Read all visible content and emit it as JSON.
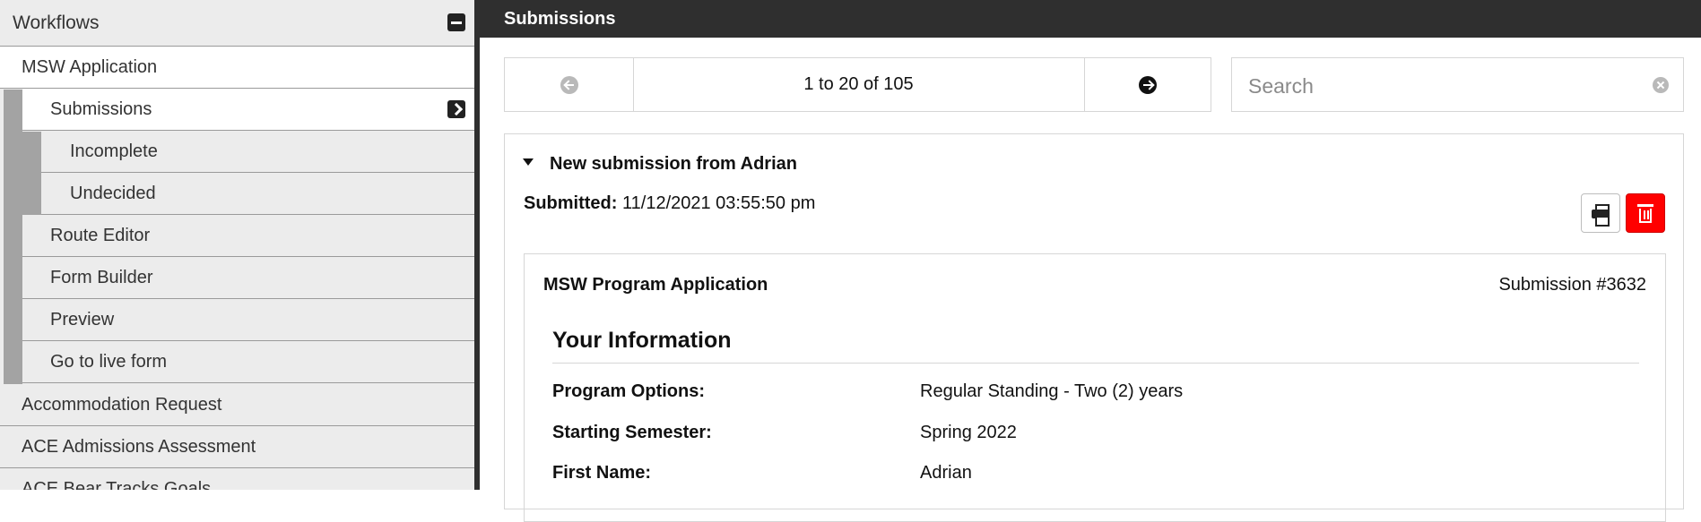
{
  "sidebar": {
    "header": "Workflows",
    "items": [
      {
        "label": "MSW Application"
      },
      {
        "label": "Submissions"
      },
      {
        "label": "Incomplete"
      },
      {
        "label": "Undecided"
      },
      {
        "label": "Route Editor"
      },
      {
        "label": "Form Builder"
      },
      {
        "label": "Preview"
      },
      {
        "label": "Go to live form"
      },
      {
        "label": "Accommodation Request"
      },
      {
        "label": "ACE Admissions Assessment"
      },
      {
        "label": "ACE Bear Tracks Goals"
      }
    ]
  },
  "topbar": {
    "title": "Submissions"
  },
  "pager": {
    "range": "1 to 20 of 105"
  },
  "search": {
    "placeholder": "Search",
    "value": ""
  },
  "submission": {
    "title": "New submission from Adrian",
    "submitted_label": "Submitted:",
    "submitted_value": "11/12/2021 03:55:50 pm",
    "form_title": "MSW Program Application",
    "number": "Submission #3632",
    "section": "Your Information",
    "fields": [
      {
        "label": "Program Options:",
        "value": "Regular Standing - Two (2) years"
      },
      {
        "label": "Starting Semester:",
        "value": "Spring 2022"
      },
      {
        "label": "First Name:",
        "value": "Adrian"
      }
    ]
  },
  "colors": {
    "topbar": "#2f2f2f",
    "delete": "#ff0000",
    "sidebar_bg": "#ececec"
  },
  "icons": [
    "collapse-icon",
    "go-icon",
    "prev-arrow-icon",
    "next-arrow-icon",
    "clear-icon",
    "print-icon",
    "trash-icon",
    "caret-down-icon"
  ]
}
